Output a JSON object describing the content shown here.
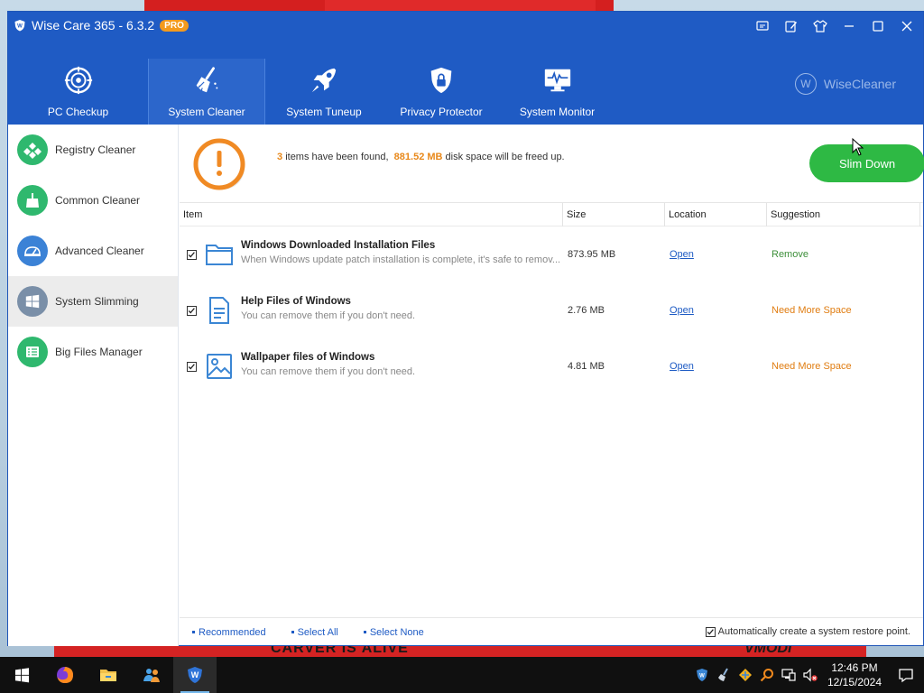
{
  "window": {
    "title": "Wise Care 365 - 6.3.2",
    "badge": "PRO",
    "brand": "WiseCleaner",
    "brand_mark": "W"
  },
  "nav": {
    "tabs": [
      {
        "label": "PC Checkup",
        "icon": "target-icon"
      },
      {
        "label": "System Cleaner",
        "icon": "broom-icon",
        "active": true
      },
      {
        "label": "System Tuneup",
        "icon": "rocket-icon"
      },
      {
        "label": "Privacy Protector",
        "icon": "shield-lock-icon"
      },
      {
        "label": "System Monitor",
        "icon": "monitor-pulse-icon"
      }
    ]
  },
  "sidebar": {
    "items": [
      {
        "label": "Registry Cleaner",
        "color": "#2fb86e"
      },
      {
        "label": "Common Cleaner",
        "color": "#2fb86e"
      },
      {
        "label": "Advanced Cleaner",
        "color": "#3b82d6"
      },
      {
        "label": "System Slimming",
        "color": "#7a8fa8",
        "active": true
      },
      {
        "label": "Big Files Manager",
        "color": "#2fb86e"
      }
    ]
  },
  "summary": {
    "count": "3",
    "text1": "items have been found,",
    "size": "881.52 MB",
    "text2": "disk space will be freed up.",
    "button": "Slim Down"
  },
  "table": {
    "headers": {
      "item": "Item",
      "size": "Size",
      "location": "Location",
      "suggestion": "Suggestion"
    },
    "rows": [
      {
        "title": "Windows Downloaded Installation Files",
        "desc": "When Windows update patch installation is complete, it's safe to remov...",
        "size": "873.95 MB",
        "location": "Open",
        "suggestion": "Remove",
        "icon": "folder-icon"
      },
      {
        "title": "Help Files of Windows",
        "desc": "You can remove them if you don't need.",
        "size": "2.76 MB",
        "location": "Open",
        "suggestion": "Need More Space",
        "icon": "document-icon"
      },
      {
        "title": "Wallpaper files of Windows",
        "desc": "You can remove them if you don't need.",
        "size": "4.81 MB",
        "location": "Open",
        "suggestion": "Need More Space",
        "icon": "image-icon"
      }
    ]
  },
  "footer": {
    "recommended": "Recommended",
    "select_all": "Select All",
    "select_none": "Select None",
    "restore": "Automatically create a system restore point."
  },
  "desktop": {
    "wall_text": "CARVER IS ALIVE",
    "wall_text2": "VMODI"
  },
  "taskbar": {
    "time": "12:46 PM",
    "date": "12/15/2024"
  }
}
